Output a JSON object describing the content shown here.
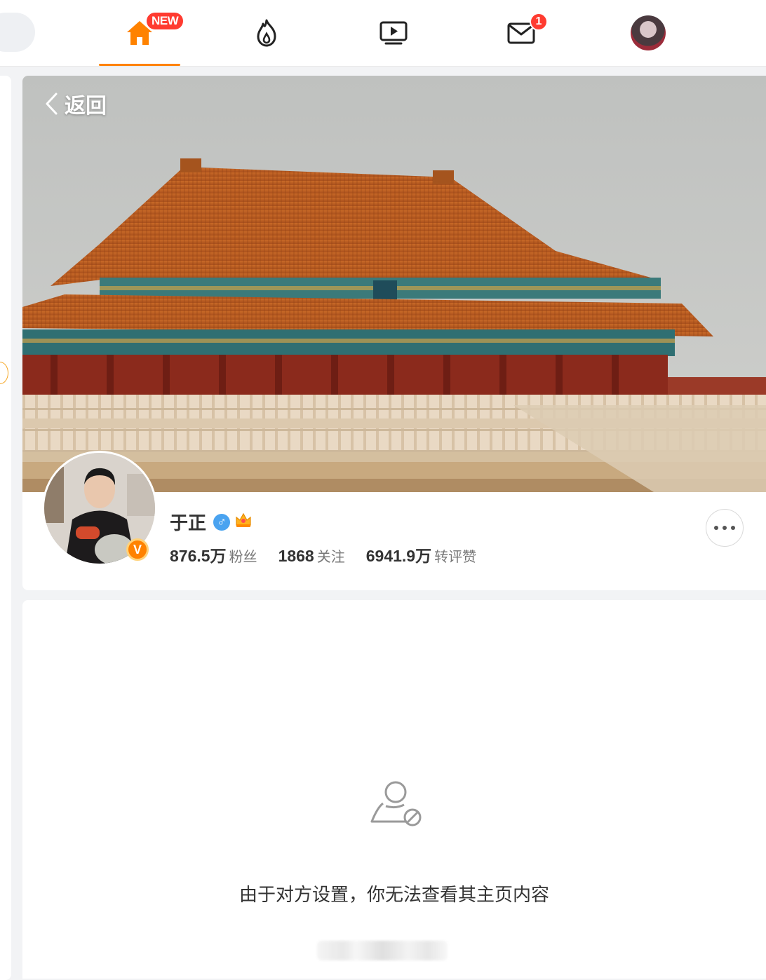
{
  "nav": {
    "home_badge": "NEW",
    "messages_badge": "1",
    "active": "home"
  },
  "profile": {
    "back_label": "返回",
    "name": "于正",
    "gender_symbol": "♂",
    "verified_symbol": "V",
    "stats": [
      {
        "value": "876.5万",
        "label": "粉丝"
      },
      {
        "value": "1868",
        "label": "关注"
      },
      {
        "value": "6941.9万",
        "label": "转评赞"
      }
    ]
  },
  "content": {
    "empty_message": "由于对方设置，你无法查看其主页内容"
  },
  "colors": {
    "accent": "#ff8200",
    "badge": "#ff3b30",
    "gender": "#4aa3f0"
  }
}
